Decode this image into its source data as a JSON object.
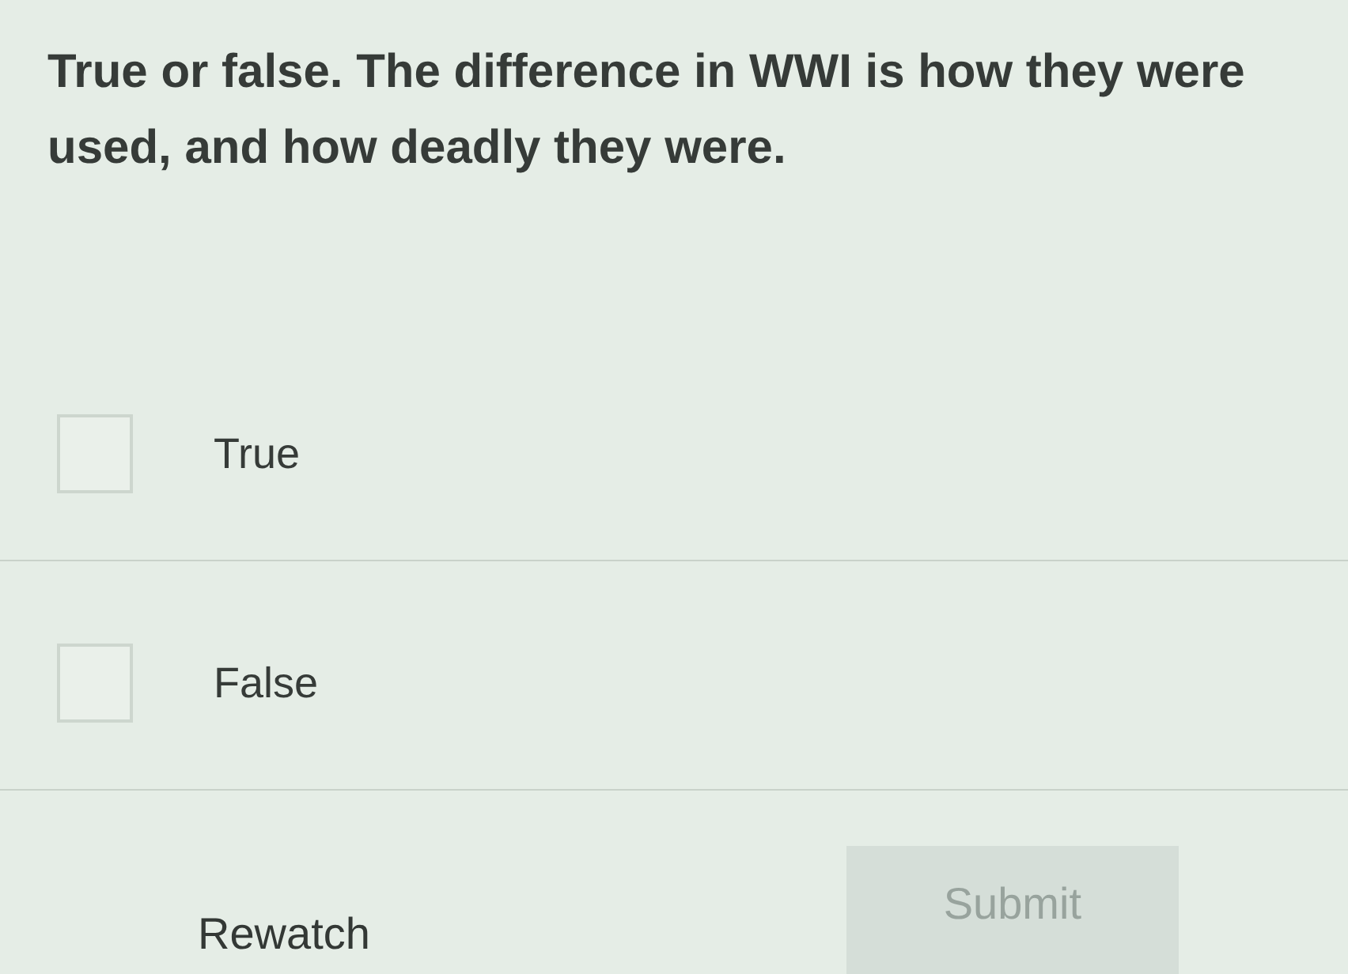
{
  "question": "True or false. The difference in WWI is how they were used, and how deadly they were.",
  "options": [
    {
      "label": "True",
      "checked": false
    },
    {
      "label": "False",
      "checked": false
    }
  ],
  "actions": {
    "rewatch": {
      "label": "Rewatch"
    },
    "submit": {
      "label": "Submit",
      "disabled": true
    }
  }
}
